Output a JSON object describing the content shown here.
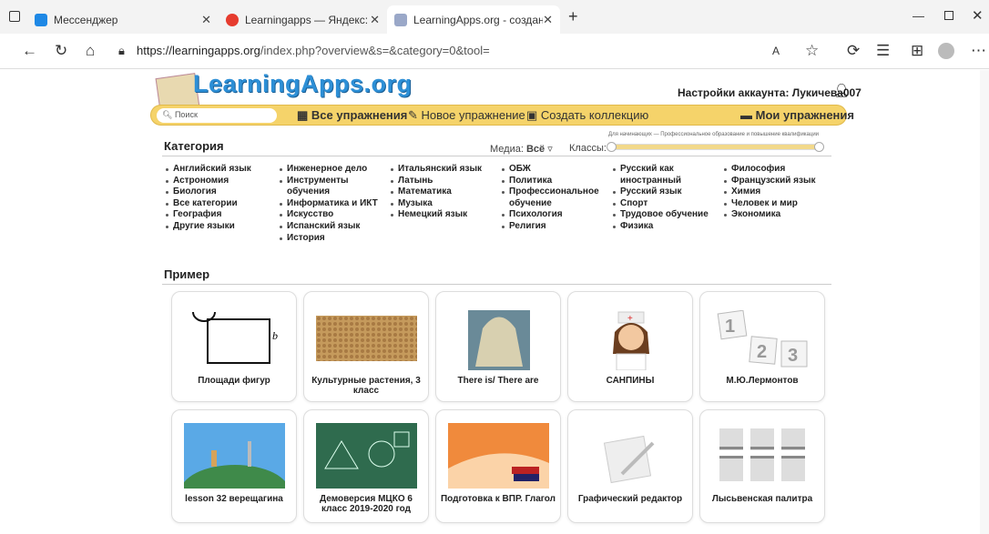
{
  "tabs": [
    {
      "label": "Мессенджер",
      "icon": "messenger-icon",
      "color": "#1e88e5"
    },
    {
      "label": "Learningapps — Яндекс: нашлось",
      "icon": "yandex-icon",
      "color": "#e63b2e"
    },
    {
      "label": "LearningApps.org - создание му",
      "icon": "learningapps-icon",
      "color": "#9aa8c8"
    }
  ],
  "address": {
    "url_host": "https://learningapps.org",
    "url_path": "/index.php?overview&s=&category=0&tool="
  },
  "site": {
    "logo": "LearningApps.org",
    "account": "Настройки аккаунта: Лукичева007",
    "search_placeholder": "Поиск",
    "menu": {
      "all": "Все упражнения",
      "new": "Новое упражнение",
      "collection": "Создать коллекцию",
      "my": "Мои упражнения"
    },
    "category_title": "Категория",
    "media_label": "Медиа:",
    "media_value": "Всё",
    "classes_label": "Классы:",
    "levels_hint": "Для начинающих — Профессиональное образование и повышение квалификации",
    "categories": [
      [
        "Английский язык",
        "Астрономия",
        "Биология",
        "Все категории",
        "География",
        "Другие языки"
      ],
      [
        "Инженерное дело",
        "Инструменты обучения",
        "Информатика и ИКТ",
        "Искусство",
        "Испанский язык",
        "История"
      ],
      [
        "Итальянский язык",
        "Латынь",
        "Математика",
        "Музыка",
        "Немецкий язык"
      ],
      [
        "ОБЖ",
        "Политика",
        "Профессиональное обучение",
        "Психология",
        "Религия"
      ],
      [
        "Русский как иностранный",
        "Русский язык",
        "Спорт",
        "Трудовое обучение",
        "Физика"
      ],
      [
        "Философия",
        "Французский язык",
        "Химия",
        "Человек и мир",
        "Экономика"
      ]
    ],
    "example_title": "Пример",
    "cards": [
      "Площади фигур",
      "Культурные растения, 3 класс",
      "There is/ There are",
      "САНПИНЫ",
      "М.Ю.Лермонтов",
      "lesson 32 верещагина",
      "Демоверсия МЦКО 6 класс 2019-2020 год",
      "Подготовка к ВПР. Глагол",
      "Графический редактор",
      "Лысьвенская палитра"
    ]
  }
}
